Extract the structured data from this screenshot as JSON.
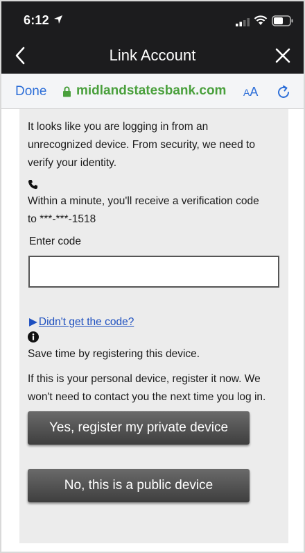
{
  "status": {
    "time": "6:12"
  },
  "nav": {
    "title": "Link Account"
  },
  "browser": {
    "done": "Done",
    "url": "midlandstatesbank.com",
    "aa_big": "A",
    "aa_small": "A"
  },
  "content": {
    "intro_line1": "It looks like you are logging in from an",
    "intro_line2": "unrecognized device. From security, we need to",
    "intro_line3": "verify your identity.",
    "code_msg_line1": "Within a minute, you'll receive a verification code",
    "code_msg_line2": "to ***-***-1518",
    "enter_code_label": "Enter code",
    "code_value": "",
    "didnt_get_code": "Didn't get the code?",
    "save_time": "Save time by registering this device.",
    "personal_line1": "If this is your personal device, register it now. We",
    "personal_line2": "won't need to contact you the next time you log in.",
    "btn_register": "Yes, register my private device",
    "btn_public": "No, this is a public device"
  }
}
